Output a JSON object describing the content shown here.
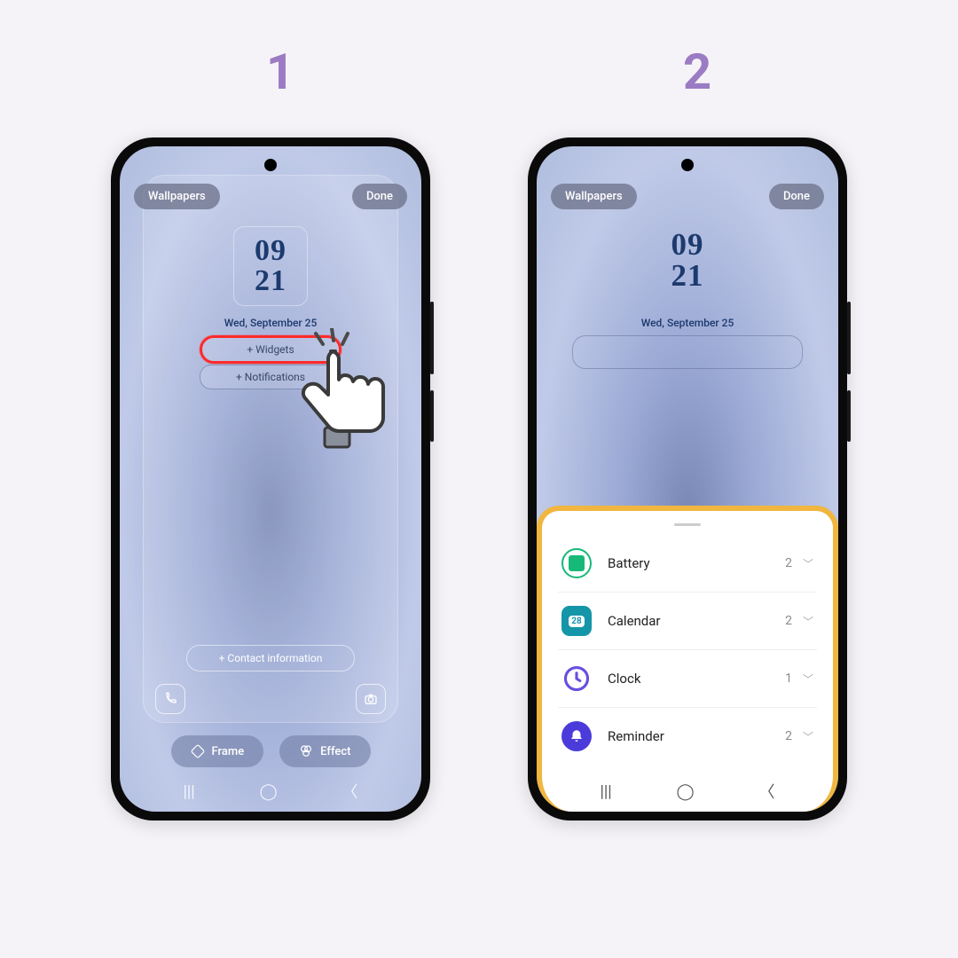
{
  "steps": {
    "one": "1",
    "two": "2"
  },
  "topbar": {
    "wallpapers": "Wallpapers",
    "done": "Done"
  },
  "clock": {
    "hour": "09",
    "min": "21"
  },
  "date": "Wed, September 25",
  "slots": {
    "widgets": "+  Widgets",
    "notifications": "+  Notifications",
    "contact": "+  Contact information"
  },
  "bottom": {
    "frame": "Frame",
    "effect": "Effect"
  },
  "calendar_day": "28",
  "widget_list": [
    {
      "label": "Battery",
      "count": "2"
    },
    {
      "label": "Calendar",
      "count": "2"
    },
    {
      "label": "Clock",
      "count": "1"
    },
    {
      "label": "Reminder",
      "count": "2"
    }
  ]
}
